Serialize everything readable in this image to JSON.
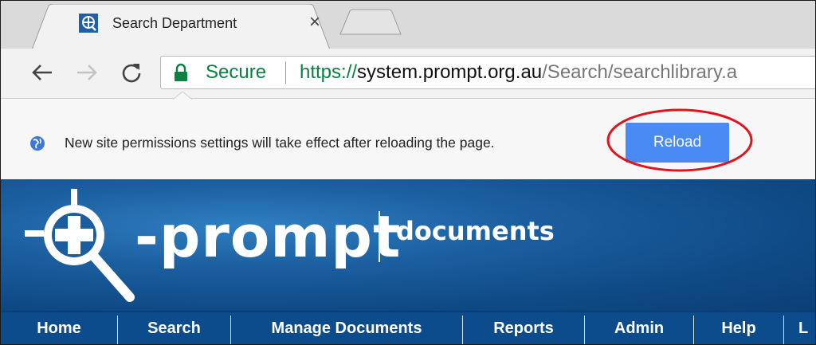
{
  "browser": {
    "tab": {
      "title": "Search Department",
      "close_glyph": "×",
      "favicon": "prompt-logo-icon"
    },
    "toolbar": {
      "back_icon": "arrow-left-icon",
      "forward_icon": "arrow-right-icon",
      "reload_icon": "reload-icon"
    },
    "omnibox": {
      "secure_label": "Secure",
      "url_scheme": "https://",
      "url_host": "system.prompt.org.au",
      "url_path": "/Search/searchlibrary.a"
    },
    "infobar": {
      "message": "New site permissions settings will take effect after reloading the page.",
      "button_label": "Reload",
      "button_color": "#4a8af4",
      "highlight_color": "#e0141e"
    }
  },
  "site": {
    "brand": "-prompt",
    "brand_sub": "documents",
    "header_color": "#1b5e9f",
    "nav": [
      {
        "label": "Home"
      },
      {
        "label": "Search"
      },
      {
        "label": "Manage Documents"
      },
      {
        "label": "Reports"
      },
      {
        "label": "Admin"
      },
      {
        "label": "Help"
      },
      {
        "label": "L"
      }
    ]
  }
}
